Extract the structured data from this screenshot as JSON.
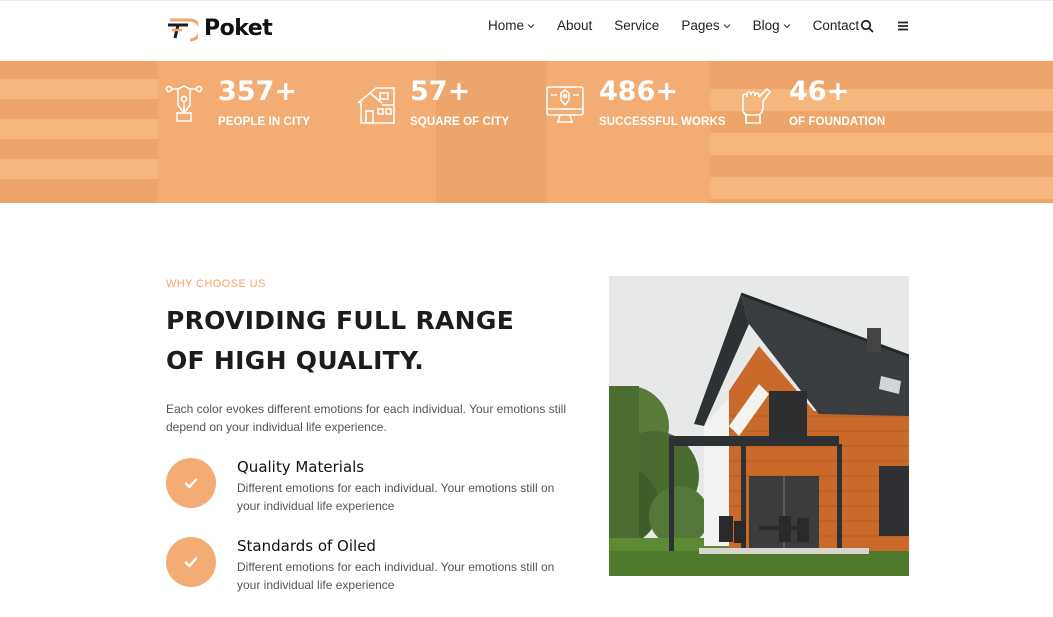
{
  "brand": {
    "name": "Poket",
    "accent": "#f3ad74"
  },
  "nav": {
    "items": [
      {
        "label": "Home",
        "dropdown": true
      },
      {
        "label": "About",
        "dropdown": false
      },
      {
        "label": "Service",
        "dropdown": false
      },
      {
        "label": "Pages",
        "dropdown": true
      },
      {
        "label": "Blog",
        "dropdown": true
      },
      {
        "label": "Contact",
        "dropdown": false
      }
    ],
    "icons": [
      "search-icon",
      "menu-icon"
    ]
  },
  "stats": [
    {
      "value": "357+",
      "label": "PEOPLE IN CITY",
      "icon": "pen-nib-icon"
    },
    {
      "value": "57+",
      "label": "SQUARE OF CITY",
      "icon": "house-icon"
    },
    {
      "value": "486+",
      "label": "SUCCESSFUL WORKS",
      "icon": "monitor-design-icon"
    },
    {
      "value": "46+",
      "label": "OF FOUNDATION",
      "icon": "hand-brush-icon"
    }
  ],
  "why": {
    "eyebrow": "WHY CHOOSE US",
    "heading_line1": "PROVIDING FULL RANGE",
    "heading_line2": "OF HIGH QUALITY.",
    "intro": "Each color evokes different emotions for each individual. Your emotions still depend on your individual life experience.",
    "features": [
      {
        "title": "Quality Materials",
        "text": "Different emotions for each individual. Your emotions still on your individual life experience"
      },
      {
        "title": "Standards of Oiled",
        "text": "Different emotions for each individual. Your emotions still on your individual life experience"
      }
    ]
  }
}
